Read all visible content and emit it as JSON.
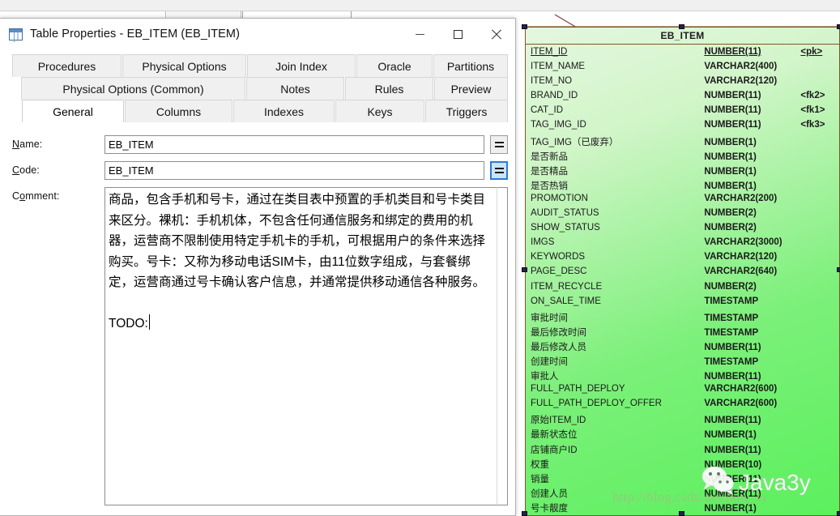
{
  "dialog": {
    "title": "Table Properties - EB_ITEM (EB_ITEM)",
    "icon": "table-icon",
    "window_controls": {
      "minimize": "minimize-icon",
      "maximize": "maximize-icon",
      "close": "close-icon"
    },
    "tab_rows": [
      [
        "Procedures",
        "Physical Options",
        "Join Index",
        "Oracle",
        "Partitions"
      ],
      [
        "Physical Options (Common)",
        "Notes",
        "Rules",
        "Preview"
      ],
      [
        "General",
        "Columns",
        "Indexes",
        "Keys",
        "Triggers"
      ]
    ],
    "active_tab": "General",
    "form": {
      "name_label": "Name:",
      "name_label_mnemonic": "N",
      "name_label_rest": "ame:",
      "name_value": "EB_ITEM",
      "code_label": "Code:",
      "code_label_mnemonic": "C",
      "code_label_rest": "ode:",
      "code_value": "EB_ITEM",
      "comment_label": "Comment:",
      "comment_label_pre": "C",
      "comment_label_mnemonic": "o",
      "comment_label_rest": "mment:",
      "comment_value": "商品，包含手机和号卡，通过在类目表中预置的手机类目和号卡类目来区分。裸机：手机机体，不包含任何通信服务和绑定的费用的机器，运营商不限制使用特定手机卡的手机，可根据用户的条件来选择购买。号卡：又称为移动电话SIM卡，由11位数字组成，与套餐绑定，运营商通过号卡确认客户信息，并通常提供移动通信各种服务。\n\nTODO:",
      "equals_button_label": "=",
      "equals_button_name": "equals-button"
    }
  },
  "diagram": {
    "table_name": "EB_ITEM",
    "columns": [
      {
        "name": "ITEM_ID",
        "type": "NUMBER(11)",
        "key": "<pk>",
        "pk": true
      },
      {
        "name": "ITEM_NAME",
        "type": "VARCHAR2(400)",
        "key": "",
        "pk": false
      },
      {
        "name": "ITEM_NO",
        "type": "VARCHAR2(120)",
        "key": "",
        "pk": false
      },
      {
        "name": "BRAND_ID",
        "type": "NUMBER(11)",
        "key": "<fk2>",
        "pk": false
      },
      {
        "name": "CAT_ID",
        "type": "NUMBER(11)",
        "key": "<fk1>",
        "pk": false
      },
      {
        "name": "TAG_IMG_ID",
        "type": "NUMBER(11)",
        "key": "<fk3>",
        "pk": false
      },
      {
        "name": "TAG_IMG（已废弃）",
        "type": "NUMBER(1)",
        "key": "",
        "pk": false
      },
      {
        "name": "是否新品",
        "type": "NUMBER(1)",
        "key": "",
        "pk": false
      },
      {
        "name": "是否精品",
        "type": "NUMBER(1)",
        "key": "",
        "pk": false
      },
      {
        "name": "是否热销",
        "type": "NUMBER(1)",
        "key": "",
        "pk": false
      },
      {
        "name": "PROMOTION",
        "type": "VARCHAR2(200)",
        "key": "",
        "pk": false
      },
      {
        "name": "AUDIT_STATUS",
        "type": "NUMBER(2)",
        "key": "",
        "pk": false
      },
      {
        "name": "SHOW_STATUS",
        "type": "NUMBER(2)",
        "key": "",
        "pk": false
      },
      {
        "name": "IMGS",
        "type": "VARCHAR2(3000)",
        "key": "",
        "pk": false
      },
      {
        "name": "KEYWORDS",
        "type": "VARCHAR2(120)",
        "key": "",
        "pk": false
      },
      {
        "name": "PAGE_DESC",
        "type": "VARCHAR2(640)",
        "key": "",
        "pk": false
      },
      {
        "name": "ITEM_RECYCLE",
        "type": "NUMBER(2)",
        "key": "",
        "pk": false
      },
      {
        "name": "ON_SALE_TIME",
        "type": "TIMESTAMP",
        "key": "",
        "pk": false
      },
      {
        "name": "审批时间",
        "type": "TIMESTAMP",
        "key": "",
        "pk": false
      },
      {
        "name": "最后修改时间",
        "type": "TIMESTAMP",
        "key": "",
        "pk": false
      },
      {
        "name": "最后修改人员",
        "type": "NUMBER(11)",
        "key": "",
        "pk": false
      },
      {
        "name": "创建时间",
        "type": "TIMESTAMP",
        "key": "",
        "pk": false
      },
      {
        "name": "审批人",
        "type": "NUMBER(11)",
        "key": "",
        "pk": false
      },
      {
        "name": "FULL_PATH_DEPLOY",
        "type": "VARCHAR2(600)",
        "key": "",
        "pk": false
      },
      {
        "name": "FULL_PATH_DEPLOY_OFFER",
        "type": "VARCHAR2(600)",
        "key": "",
        "pk": false
      },
      {
        "name": "原始ITEM_ID",
        "type": "NUMBER(11)",
        "key": "",
        "pk": false
      },
      {
        "name": "最新状态位",
        "type": "NUMBER(1)",
        "key": "",
        "pk": false
      },
      {
        "name": "店铺商户ID",
        "type": "NUMBER(11)",
        "key": "",
        "pk": false
      },
      {
        "name": "权重",
        "type": "NUMBER(10)",
        "key": "",
        "pk": false
      },
      {
        "name": "销量",
        "type": "NUMBER(11)",
        "key": "",
        "pk": false
      },
      {
        "name": "创建人员",
        "type": "NUMBER(11)",
        "key": "",
        "pk": false
      },
      {
        "name": "号卡靓度",
        "type": "NUMBER(1)",
        "key": "",
        "pk": false
      }
    ]
  },
  "watermark": {
    "brand": "Java3y",
    "url": "http://blog.csdn.net/hon_3y",
    "logo": "wechat-icon"
  },
  "colors": {
    "table_fill_light": "#e4f7e0",
    "table_fill_dark": "#5bf05d",
    "table_border": "#7a5a28",
    "accent_focus": "#2b7cd3",
    "relationship_line": "#8a3a3a"
  }
}
